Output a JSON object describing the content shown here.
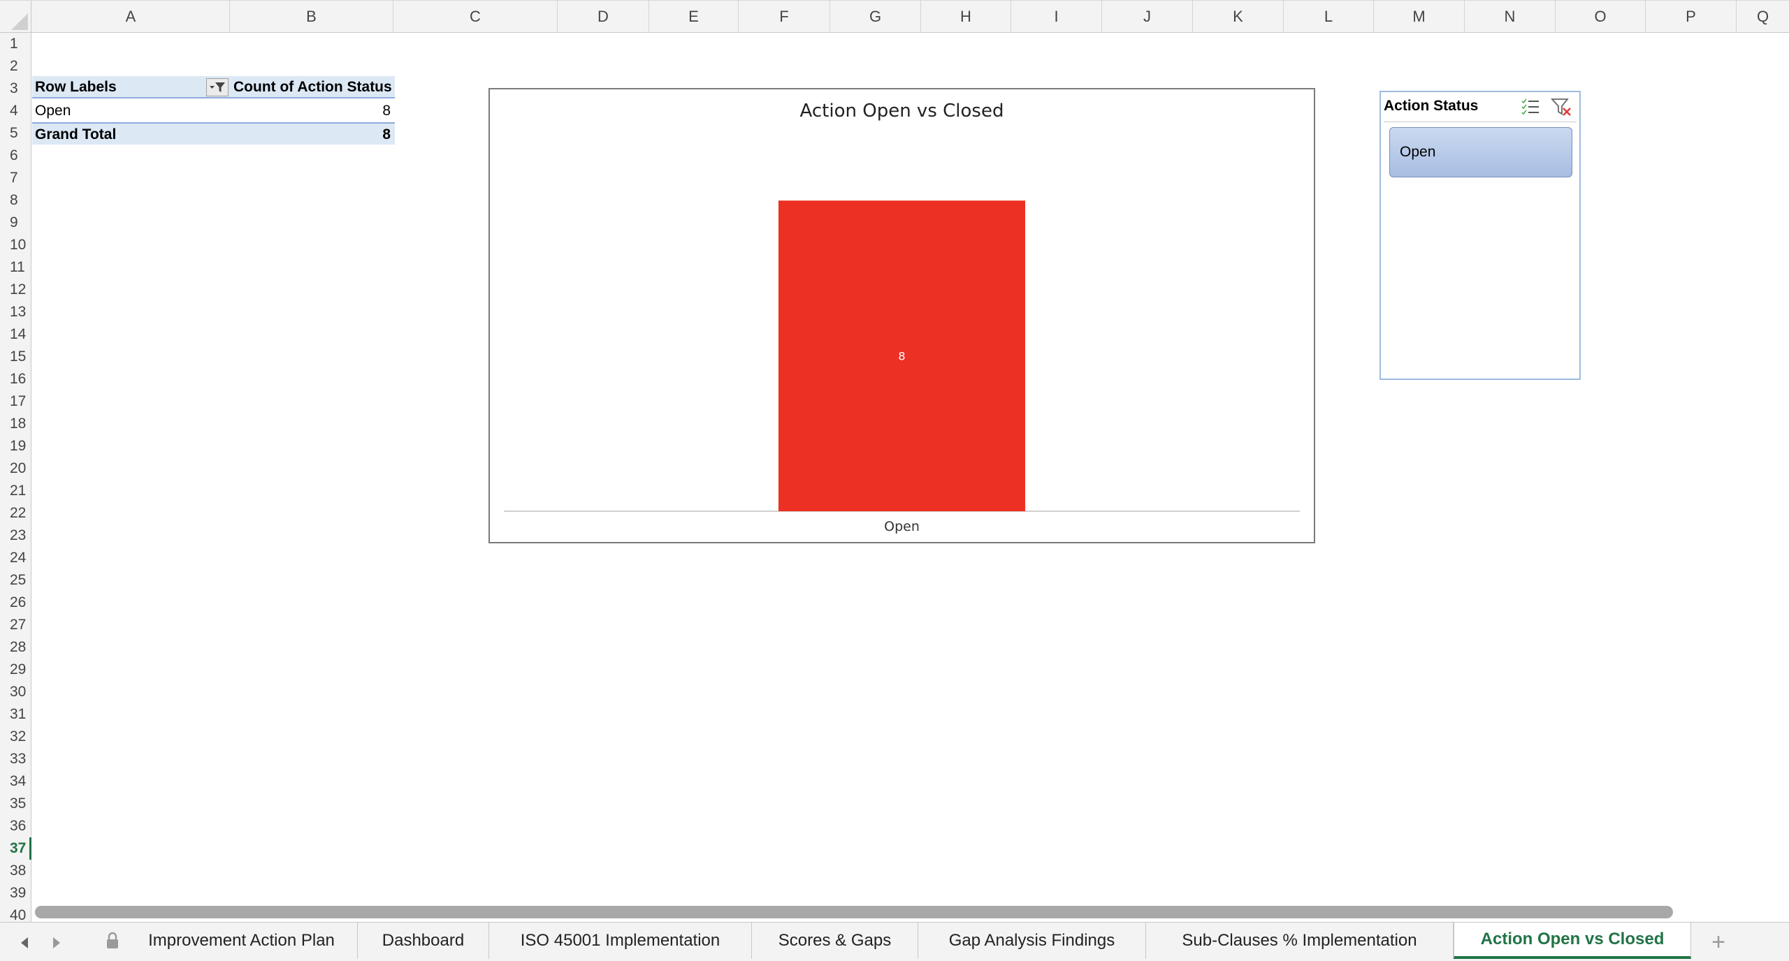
{
  "columns": [
    "A",
    "B",
    "C",
    "D",
    "E",
    "F",
    "G",
    "H",
    "I",
    "J",
    "K",
    "L",
    "M",
    "N",
    "O",
    "P",
    "Q"
  ],
  "rows": [
    "1",
    "2",
    "3",
    "4",
    "5",
    "6",
    "7",
    "8",
    "9",
    "10",
    "11",
    "12",
    "13",
    "14",
    "15",
    "16",
    "17",
    "18",
    "19",
    "20",
    "21",
    "22",
    "23",
    "24",
    "25",
    "26",
    "27",
    "28",
    "29",
    "30",
    "31",
    "32",
    "33",
    "34",
    "35",
    "36",
    "37",
    "38",
    "39",
    "40"
  ],
  "active_row": "37",
  "pivot": {
    "header": {
      "row_labels": "Row Labels",
      "count_label": "Count of Action Status"
    },
    "rows": [
      {
        "label": "Open",
        "value": "8"
      }
    ],
    "total": {
      "label": "Grand Total",
      "value": "8"
    }
  },
  "chart_data": {
    "type": "bar",
    "title": "Action Open vs Closed",
    "categories": [
      "Open"
    ],
    "values": [
      8
    ],
    "data_labels": [
      "8"
    ],
    "colors": {
      "bar": "#ed3024",
      "label": "#ffffff",
      "axis": "#d0d0d0"
    },
    "ylim": [
      0,
      10
    ],
    "grid": false,
    "legend": "none"
  },
  "slicer": {
    "title": "Action Status",
    "items": [
      "Open"
    ],
    "icons": {
      "multi_select": "multi-select-icon",
      "clear_filter": "clear-filter-icon"
    }
  },
  "sheet_tabs": [
    {
      "label": "Improvement Action Plan",
      "locked": true
    },
    {
      "label": "Dashboard"
    },
    {
      "label": "ISO 45001 Implementation"
    },
    {
      "label": "Scores & Gaps"
    },
    {
      "label": "Gap Analysis Findings"
    },
    {
      "label": "Sub-Clauses % Implementation"
    },
    {
      "label": "Action Open vs Closed",
      "active": true
    }
  ],
  "add_sheet_label": "+",
  "accent": "#217346"
}
